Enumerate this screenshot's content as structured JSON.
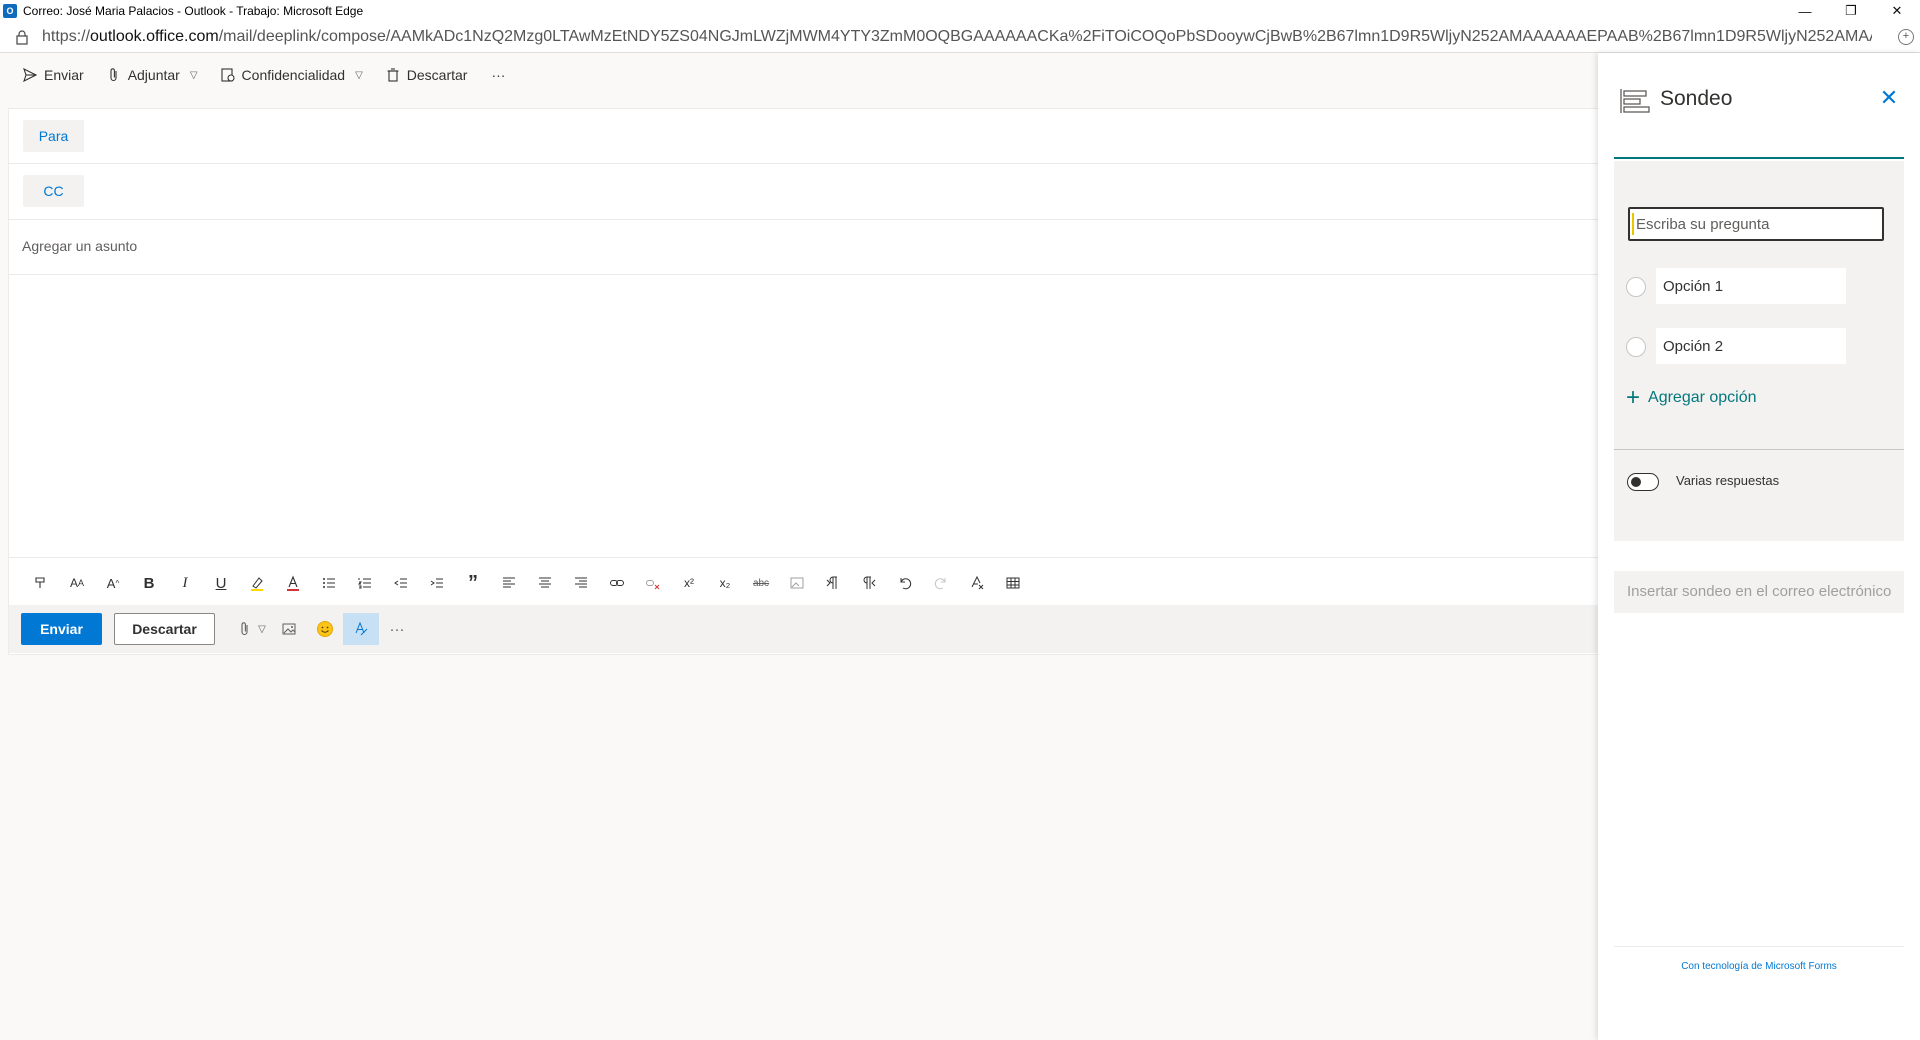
{
  "window": {
    "title": "Correo: José Maria Palacios - Outlook - Trabajo: Microsoft Edge",
    "app_icon": "O",
    "controls": {
      "minimize": "—",
      "restore": "❐",
      "close": "✕"
    }
  },
  "address": {
    "url_prefix": "https://",
    "url_host": "outlook.office.com",
    "url_path": "/mail/deeplink/compose/AAMkADc1NzQ2Mzg0LTAwMzEtNDY5ZS04NGJmLWZjMWM4YTY3ZmM0OQBGAAAAAACKa%2FiTOiCOQoPbSDooywCjBwB%2B67lmn1D9R5WljyN252AMAAAAAAEPAAB%2B67lmn1D9R5WljyN252AMAAOFV...",
    "fav_icon": "+"
  },
  "toolbar": {
    "send": "Enviar",
    "attach": "Adjuntar",
    "confidentiality": "Confidencialidad",
    "discard": "Descartar",
    "more": "···"
  },
  "compose": {
    "to_label": "Para",
    "cc_label": "CC",
    "subject_placeholder": "Agregar un asunto",
    "send_button": "Enviar",
    "discard_button": "Descartar",
    "more": "···"
  },
  "format": {
    "bold": "B",
    "italic": "I",
    "underline": "U",
    "quote": "”",
    "superscript": "x²",
    "subscript": "x₂",
    "strike": "abc"
  },
  "poll": {
    "title": "Sondeo",
    "question_placeholder": "Escriba su pregunta",
    "options": [
      "Opción 1",
      "Opción 2"
    ],
    "add_option": "Agregar opción",
    "add_option_symbol": "+",
    "close_symbol": "✕",
    "multiple_answers": "Varias respuestas",
    "multiple_answers_on": false,
    "insert_button": "Insertar sondeo en el correo electrónico",
    "footer": "Con tecnología de Microsoft Forms"
  },
  "colors": {
    "accent": "#0078d4",
    "poll_accent": "#03787c"
  }
}
